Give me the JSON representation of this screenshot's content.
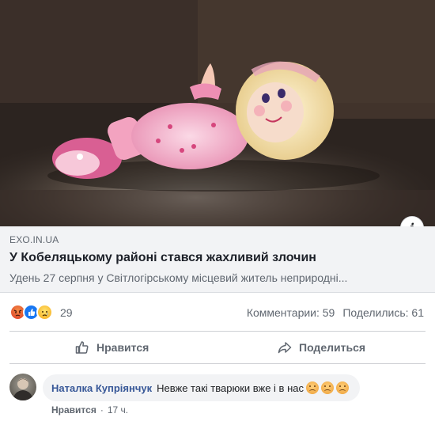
{
  "link_preview": {
    "domain": "EXO.IN.UA",
    "headline": "У Кобеляцькому районі стався жахливий злочин",
    "snippet": "Удень 27 серпня у Світлогірському місцевий житель неприродні...",
    "info_label": "i"
  },
  "reactions": {
    "icons": [
      "angry-reaction",
      "like-reaction",
      "sad-reaction"
    ],
    "count": "29"
  },
  "stats": {
    "comments": "Комментарии: 59",
    "shares": "Поделились: 61"
  },
  "actions": {
    "like_label": "Нравится",
    "share_label": "Поделиться"
  },
  "comment": {
    "author": "Наталка Купріянчук",
    "text": "Невже такі тварюки вже і в нас",
    "emoji": [
      "frowning-face",
      "frowning-face",
      "frowning-face"
    ],
    "like_label": "Нравится",
    "separator": "·",
    "time": "17 ч."
  },
  "colors": {
    "link_blue": "#385898",
    "like_blue": "#1877f2",
    "meta_gray": "#606770",
    "preview_bg": "#f2f3f5"
  }
}
